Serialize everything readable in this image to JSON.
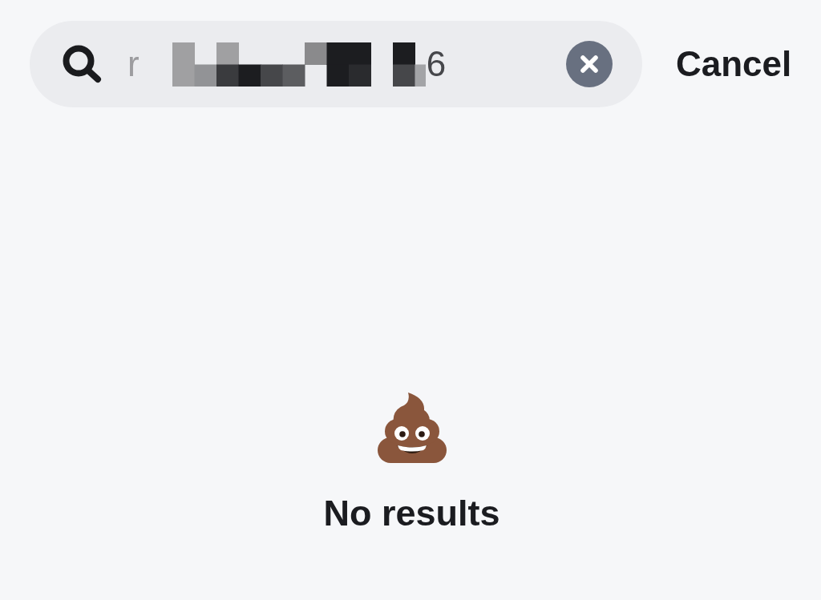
{
  "search_bar": {
    "value_start": "r",
    "value_end": "6",
    "redacted": true,
    "clear_button": true
  },
  "cancel_button": {
    "label": "Cancel"
  },
  "empty_state": {
    "message": "No results"
  }
}
